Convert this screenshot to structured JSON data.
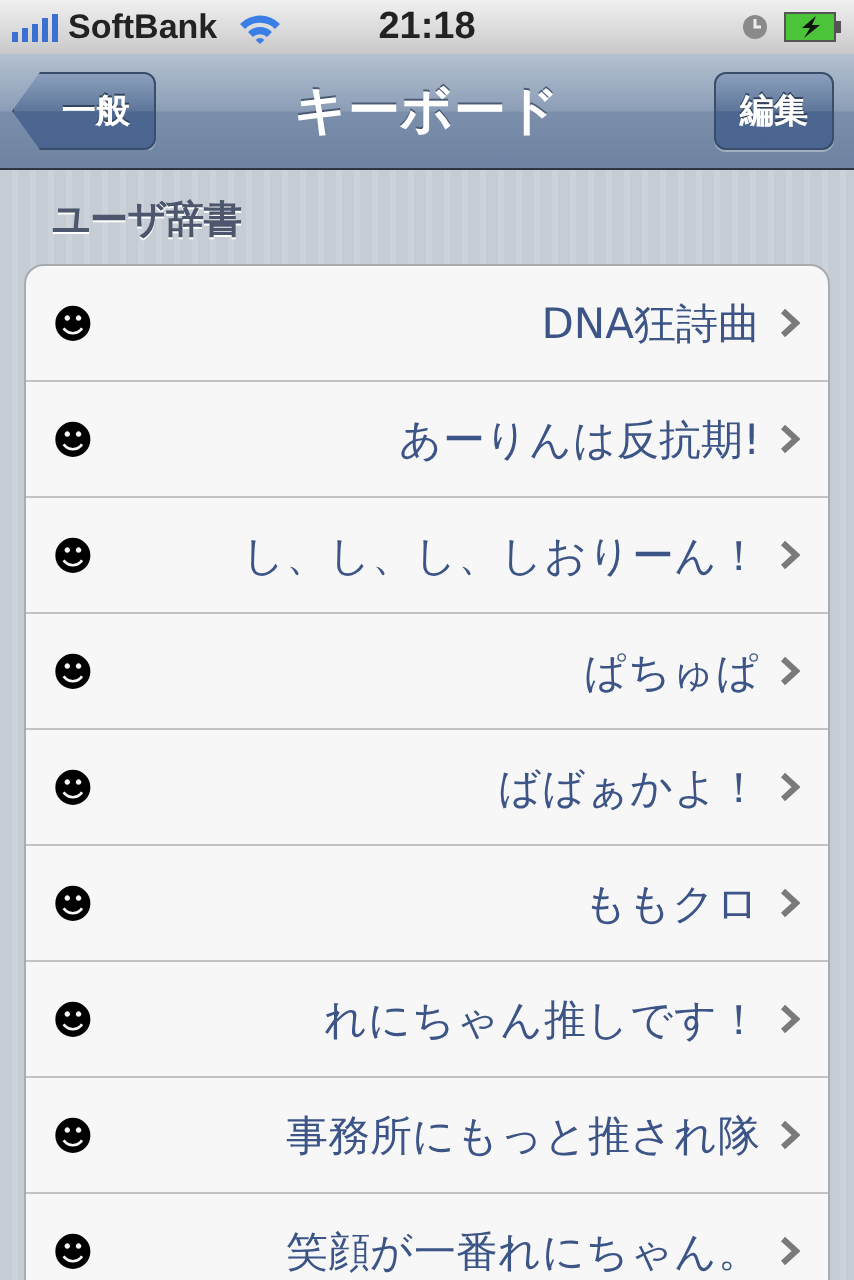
{
  "status_bar": {
    "carrier": "SoftBank",
    "time": "21:18"
  },
  "nav_bar": {
    "back_button": "一般",
    "title": "キーボード",
    "edit_button": "編集"
  },
  "section": {
    "title": "ユーザ辞書",
    "entries": [
      {
        "shortcut": "☻",
        "phrase": "DNA狂詩曲"
      },
      {
        "shortcut": "☻",
        "phrase": "あーりんは反抗期!"
      },
      {
        "shortcut": "☻",
        "phrase": "し、し、し、しおりーん！"
      },
      {
        "shortcut": "☻",
        "phrase": "ぱちゅぱ"
      },
      {
        "shortcut": "☻",
        "phrase": "ばばぁかよ！"
      },
      {
        "shortcut": "☻",
        "phrase": "ももクロ"
      },
      {
        "shortcut": "☻",
        "phrase": "れにちゃん推しです！"
      },
      {
        "shortcut": "☻",
        "phrase": "事務所にもっと推され隊"
      },
      {
        "shortcut": "☻",
        "phrase": "笑顔が一番れにちゃん。"
      }
    ]
  }
}
